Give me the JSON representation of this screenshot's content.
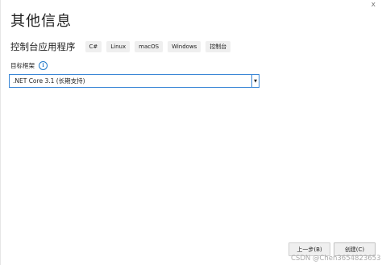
{
  "window": {
    "close_glyph": "x"
  },
  "title": "其他信息",
  "template": {
    "name": "控制台应用程序",
    "tags": [
      "C#",
      "Linux",
      "macOS",
      "Windows",
      "控制台"
    ]
  },
  "framework": {
    "label": "目标框架",
    "info_icon": "i",
    "selected": ".NET Core 3.1 (长期支持)",
    "arrow": "▼"
  },
  "buttons": {
    "back_label": "上一步(B)",
    "create_label": "创建(C)"
  },
  "watermark": "CSDN @Chen3654823653"
}
